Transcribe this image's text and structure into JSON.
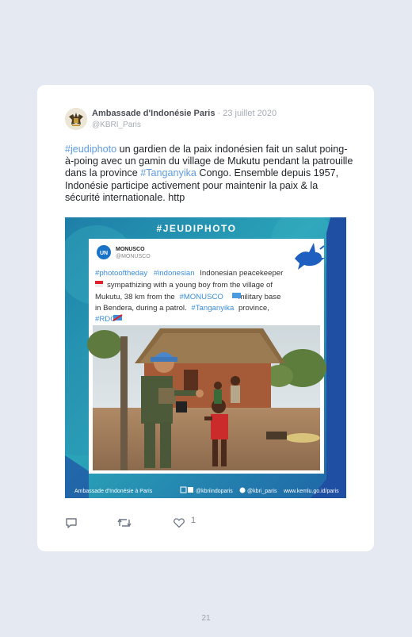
{
  "tweet": {
    "author_name": "Ambassade d'Indonésie Paris",
    "date": "23 juillet 2020",
    "handle": "@KBRI_Paris",
    "text_parts": {
      "tag1": "#jeudiphoto",
      "body1": " un gardien de la paix indonésien fait un salut poing-à-poing avec un gamin du village de Mukutu pendant la patrouille dans la province ",
      "tag2": "#Tanganyika",
      "body2": " Congo. Ensemble depuis 1957, Indonésie participe activement pour maintenir la paix & la sécurité internationale. http"
    },
    "media": {
      "banner": "#JEUDIPHOTO",
      "inner_account": "MONUSCO",
      "inner_handle": "@MONUSCO",
      "inner_logo": "UN",
      "caption": {
        "tag_a": "#photooftheday",
        "tag_b": "#indonesian",
        "line1": "Indonesian peacekeeper",
        "line2": "sympathizing with a young boy from the village of",
        "line3a": "Mukutu, 38 km from the",
        "tag_c": "#MONUSCO",
        "line3b": "military base",
        "line4a": "in Bendera, during a patrol.",
        "tag_d": "#Tanganyika",
        "line4b": "province,",
        "tag_e": "#RDC"
      },
      "footer_org": "Ambassade d'Indonésie à Paris",
      "footer_social1": "@kbriindoparis",
      "footer_social2": "@kbri_paris",
      "footer_url": "www.kemlu.go.id/paris"
    },
    "like_count": "1",
    "icons": {
      "reply": "comment-icon",
      "retweet": "retweet-icon",
      "like": "heart-icon"
    }
  },
  "page_number": "21",
  "colors": {
    "background": "#e5e9f1",
    "card": "#ffffff",
    "hashtag": "#5d9be3",
    "frame_blue": "#1e4fa3"
  }
}
